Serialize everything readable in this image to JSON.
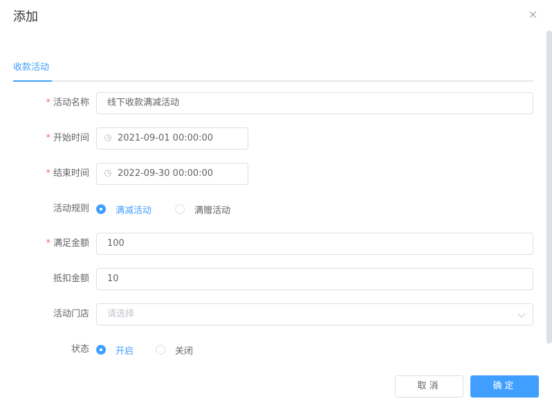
{
  "dialog": {
    "title": "添加"
  },
  "tabs": [
    {
      "label": "收款活动",
      "active": true
    }
  ],
  "form": {
    "activity_name": {
      "label": "活动名称",
      "required": true,
      "value": "线下收款满减活动"
    },
    "start_time": {
      "label": "开始时间",
      "required": true,
      "value": "2021-09-01 00:00:00"
    },
    "end_time": {
      "label": "结束时间",
      "required": true,
      "value": "2022-09-30 00:00:00"
    },
    "rule": {
      "label": "活动规则",
      "options": [
        "满减活动",
        "满赠活动"
      ],
      "selected": "满减活动"
    },
    "threshold_amount": {
      "label": "满足金额",
      "required": true,
      "value": "100"
    },
    "deduct_amount": {
      "label": "抵扣金额",
      "value": "10"
    },
    "stores": {
      "label": "活动门店",
      "placeholder": "请选择",
      "value": ""
    },
    "status": {
      "label": "状态",
      "options": [
        "开启",
        "关闭"
      ],
      "selected": "开启"
    }
  },
  "footer": {
    "cancel_label": "取消",
    "ok_label": "确定"
  },
  "colors": {
    "primary": "#409eff",
    "required": "#f56c6c",
    "border": "#dcdfe6"
  }
}
